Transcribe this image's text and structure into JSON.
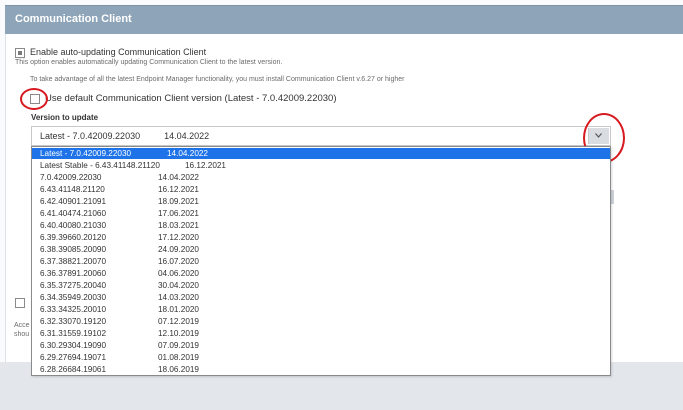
{
  "header": {
    "title": "Communication Client"
  },
  "auto_update": {
    "label": "Enable auto-updating Communication Client",
    "description": "This option enables automatically updating Communication Client to the latest version.",
    "checked": true
  },
  "info_text": "To take advantage of all the latest Endpoint Manager functionality, you must install Communication Client v.6.27 or higher",
  "default_version": {
    "label": "Use default Communication Client version (Latest - 7.0.42009.22030)",
    "checked": false
  },
  "version_to_update": {
    "label": "Version to update",
    "selected_version": "Latest - 7.0.42009.22030",
    "selected_date": "14.04.2022"
  },
  "options": [
    {
      "version": "Latest - 7.0.42009.22030",
      "date": "14.04.2022",
      "selected": true
    },
    {
      "version": "Latest Stable - 6.43.41148.21120",
      "date": "16.12.2021"
    },
    {
      "version": "7.0.42009.22030",
      "date": "14.04.2022"
    },
    {
      "version": "6.43.41148.21120",
      "date": "16.12.2021"
    },
    {
      "version": "6.42.40901.21091",
      "date": "18.09.2021"
    },
    {
      "version": "6.41.40474.21060",
      "date": "17.06.2021"
    },
    {
      "version": "6.40.40080.21030",
      "date": "18.03.2021"
    },
    {
      "version": "6.39.39660.20120",
      "date": "17.12.2020"
    },
    {
      "version": "6.38.39085.20090",
      "date": "24.09.2020"
    },
    {
      "version": "6.37.38821.20070",
      "date": "16.07.2020"
    },
    {
      "version": "6.36.37891.20060",
      "date": "04.06.2020"
    },
    {
      "version": "6.35.37275.20040",
      "date": "30.04.2020"
    },
    {
      "version": "6.34.35949.20030",
      "date": "14.03.2020"
    },
    {
      "version": "6.33.34325.20010",
      "date": "18.01.2020"
    },
    {
      "version": "6.32.33070.19120",
      "date": "07.12.2019"
    },
    {
      "version": "6.31.31559.19102",
      "date": "12.10.2019"
    },
    {
      "version": "6.30.29304.19090",
      "date": "07.09.2019"
    },
    {
      "version": "6.29.27694.19071",
      "date": "01.08.2019"
    },
    {
      "version": "6.28.26684.19061",
      "date": "18.06.2019"
    }
  ],
  "hidden_fragments": {
    "a": "Acce",
    "b": "shou"
  },
  "colors": {
    "header_bg": "#8ea4b8",
    "selected_bg": "#1e73e8",
    "highlight_circle": "#d71920"
  }
}
